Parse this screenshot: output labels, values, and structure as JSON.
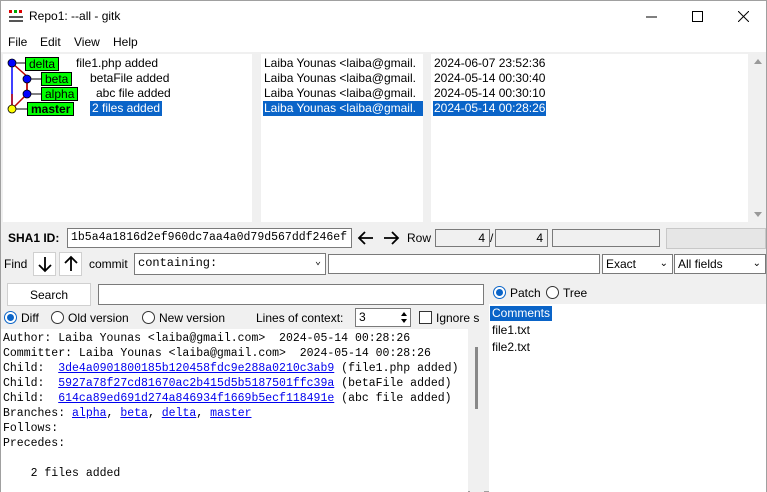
{
  "window": {
    "title": "Repo1: --all - gitk"
  },
  "menu": [
    "File",
    "Edit",
    "View",
    "Help"
  ],
  "commits": [
    {
      "refs": [
        "delta"
      ],
      "subject": "file1.php added",
      "author": "Laiba Younas <laiba@gmail.",
      "date": "2024-06-07 23:52:36"
    },
    {
      "refs": [
        "beta"
      ],
      "subject": "betaFile added",
      "author": "Laiba Younas <laiba@gmail.",
      "date": "2024-05-14 00:30:40"
    },
    {
      "refs": [
        "alpha"
      ],
      "subject": "abc file added",
      "author": "Laiba Younas <laiba@gmail.",
      "date": "2024-05-14 00:30:10"
    },
    {
      "refs": [
        "master"
      ],
      "subject": "2 files added",
      "author": "Laiba Younas <laiba@gmail.",
      "date": "2024-05-14 00:28:26",
      "selected": true
    }
  ],
  "sha": {
    "label": "SHA1 ID:",
    "value": "1b5a4a1816d2ef960dc7aa4a0d79d567ddf246ef"
  },
  "row": {
    "label": "Row",
    "current": "4",
    "sep": "/",
    "total": "4"
  },
  "find": {
    "label": "Find",
    "type_label": "commit",
    "mode": "containing:",
    "match": "Exact",
    "fields": "All fields"
  },
  "search": {
    "button": "Search"
  },
  "diff_opts": {
    "diff": "Diff",
    "old": "Old version",
    "new": "New version",
    "context_label": "Lines of context:",
    "context_value": "3",
    "ignore": "Ignore s"
  },
  "details": {
    "author": "Author: Laiba Younas <laiba@gmail.com>  2024-05-14 00:28:26",
    "committer": "Committer: Laiba Younas <laiba@gmail.com>  2024-05-14 00:28:26",
    "children": [
      {
        "prefix": "Child:  ",
        "sha": "3de4a0901800185b120458fdc9e288a0210c3ab9",
        "note": " (file1.php added)"
      },
      {
        "prefix": "Child:  ",
        "sha": "5927a78f27cd81670ac2b415d5b5187501ffc39a",
        "note": " (betaFile added)"
      },
      {
        "prefix": "Child:  ",
        "sha": "614ca89ed691d274a846934f1669b5ecf118491e",
        "note": " (abc file added)"
      }
    ],
    "branches_label": "Branches: ",
    "branches": [
      "alpha",
      "beta",
      "delta",
      "master"
    ],
    "follows": "Follows:",
    "precedes": "Precedes:",
    "message": "    2 files added"
  },
  "filepane": {
    "patch": "Patch",
    "tree": "Tree",
    "files": [
      "Comments",
      "file1.txt",
      "file2.txt"
    ]
  }
}
